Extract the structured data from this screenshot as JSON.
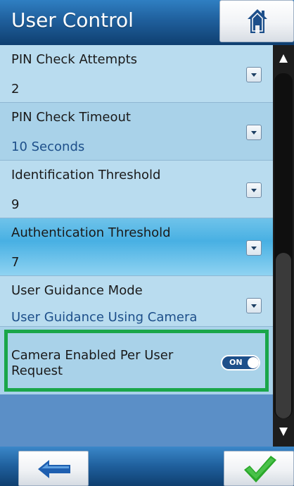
{
  "header": {
    "title": "User Control",
    "home_icon": "home-icon"
  },
  "settings": [
    {
      "label": "PIN Check Attempts",
      "value": "2",
      "value_style": "dark",
      "selected": false
    },
    {
      "label": "PIN Check Timeout",
      "value": "10 Seconds",
      "value_style": "blue",
      "selected": false
    },
    {
      "label": "Identification Threshold",
      "value": "9",
      "value_style": "dark",
      "selected": false
    },
    {
      "label": "Authentication Threshold",
      "value": "7",
      "value_style": "dark",
      "selected": true
    },
    {
      "label": "User Guidance Mode",
      "value": "User Guidance Using Camera",
      "value_style": "blue",
      "selected": false
    }
  ],
  "camera_setting": {
    "label": "Camera Enabled Per User Request",
    "toggle_text": "ON",
    "enabled": true
  },
  "scrollbar": {
    "position_fraction": 0.52,
    "visible_fraction": 0.48
  },
  "footer": {
    "back_icon": "back-arrow-icon",
    "confirm_icon": "checkmark-icon"
  },
  "colors": {
    "header_blue": "#1f5f9c",
    "row_light": "#b9dcef",
    "row_selected": "#48b0e3",
    "highlight_green": "#1aa64a",
    "value_blue": "#1d4f8a",
    "confirm_green": "#2aa82a",
    "back_blue": "#1e5fb0"
  }
}
